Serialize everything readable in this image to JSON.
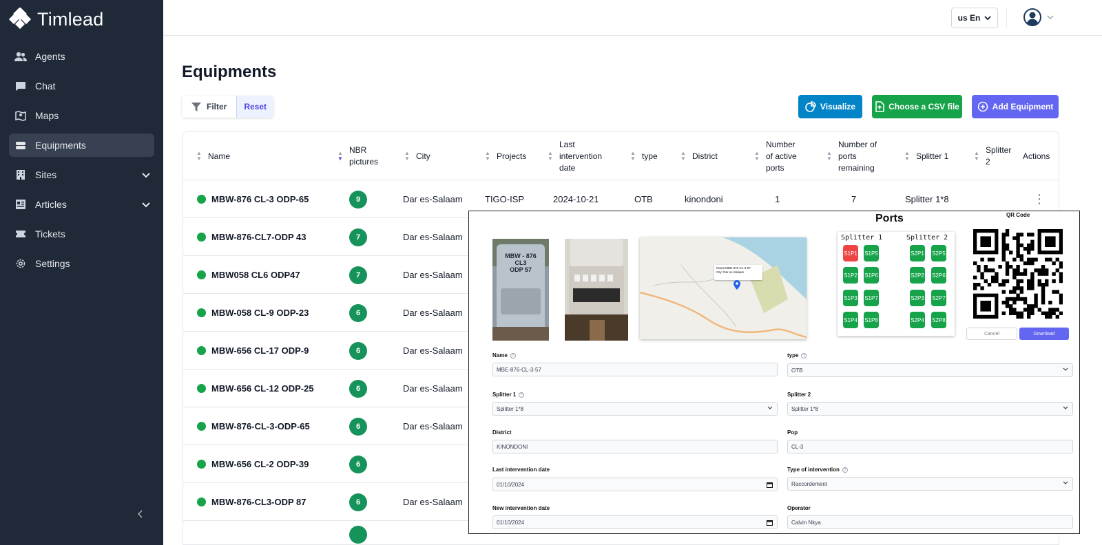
{
  "app": {
    "brand_name": "Timlead"
  },
  "sidebar": {
    "items": [
      {
        "label": "Agents",
        "icon": "users-icon"
      },
      {
        "label": "Chat",
        "icon": "chat-icon"
      },
      {
        "label": "Maps",
        "icon": "map-icon"
      },
      {
        "label": "Equipments",
        "icon": "equipment-icon",
        "active": true
      },
      {
        "label": "Sites",
        "icon": "building-icon",
        "expandable": true
      },
      {
        "label": "Articles",
        "icon": "articles-icon",
        "expandable": true
      },
      {
        "label": "Tickets",
        "icon": "ticket-icon"
      },
      {
        "label": "Settings",
        "icon": "gear-icon"
      }
    ]
  },
  "header": {
    "language": "us En"
  },
  "page": {
    "title": "Equipments"
  },
  "toolbar": {
    "filter_label": "Filter",
    "reset_label": "Reset",
    "visualize_label": "Visualize",
    "csv_label": "Choose a CSV file",
    "add_label": "Add Equipment"
  },
  "table": {
    "columns": {
      "name": "Name",
      "pictures_1": "NBR",
      "pictures_2": "pictures",
      "city": "City",
      "projects": "Projects",
      "date_1": "Last",
      "date_2": "intervention",
      "date_3": "date",
      "type": "type",
      "district": "District",
      "active_1": "Number",
      "active_2": "of active",
      "active_3": "ports",
      "remain_1": "Number of",
      "remain_2": "ports",
      "remain_3": "remaining",
      "splitter1": "Splitter 1",
      "splitter2_1": "Splitter",
      "splitter2_2": "2",
      "actions": "Actions"
    },
    "rows": [
      {
        "name": "MBW-876 CL-3 ODP-65",
        "pictures": "9",
        "city": "Dar es-Salaam",
        "projects": "TIGO-ISP",
        "date": "2024-10-21",
        "type": "OTB",
        "district": "kinondoni",
        "active": "1",
        "remaining": "7",
        "splitter1": "Splitter 1*8"
      },
      {
        "name": "MBW-876-CL7-ODP 43",
        "pictures": "7",
        "city": "Dar es-Salaam"
      },
      {
        "name": "MBW058 CL6 ODP47",
        "pictures": "7",
        "city": "Dar es-Salaam"
      },
      {
        "name": "MBW-058 CL-9 ODP-23",
        "pictures": "6",
        "city": "Dar es-Salaam"
      },
      {
        "name": "MBW-656 CL-17 ODP-9",
        "pictures": "6",
        "city": "Dar es-Salaam"
      },
      {
        "name": "MBW-656 CL-12 ODP-25",
        "pictures": "6",
        "city": "Dar es-Salaam"
      },
      {
        "name": "MBW-876-CL-3-ODP-65",
        "pictures": "6",
        "city": "Dar es-Salaam"
      },
      {
        "name": "MBW-656 CL-2 ODP-39",
        "pictures": "6",
        "city": ""
      },
      {
        "name": "MBW-876-CL3-ODP 87",
        "pictures": "6",
        "city": "Dar es-Salaam"
      }
    ]
  },
  "detail": {
    "ports_title": "Ports",
    "qr_title": "QR Code",
    "photo_label": "MBW - 876\nCL3\nODP 57",
    "map_popup_name": "Name:MBE-876-CL-3-57",
    "map_popup_city": "City: Dar es-Salaam",
    "splitter1_title": "Splitter 1",
    "splitter2_title": "Splitter 2",
    "ports_s1": [
      "S1P1",
      "S1P5",
      "S1P2",
      "S1P6",
      "S1P3",
      "S1P7",
      "S1P4",
      "S1P8"
    ],
    "ports_s2": [
      "S2P1",
      "S2P5",
      "S2P2",
      "S2P6",
      "S2P3",
      "S2P7",
      "S2P4",
      "S2P8"
    ],
    "cancel_label": "Cancel",
    "download_label": "Download",
    "fields": {
      "name_label": "Name",
      "name_value": "MBE-876-CL-3-57",
      "type_label": "type",
      "type_value": "OTB",
      "splitter1_label": "Splitter 1",
      "splitter1_value": "Splitter 1*8",
      "splitter2_label": "Splitter 2",
      "splitter2_value": "Splitter 1*8",
      "district_label": "District",
      "district_value": "KINONDONI",
      "pop_label": "Pop",
      "pop_value": "CL-3",
      "last_date_label": "Last intervention date",
      "last_date_value": "01/10/2024",
      "intervention_type_label": "Type of intervention",
      "intervention_type_value": "Raccordement",
      "new_date_label": "New intervention date",
      "new_date_value": "01/10/2024",
      "operator_label": "Operator",
      "operator_value": "Calvin Nkya"
    }
  },
  "colors": {
    "sidebar": "#1f2937",
    "accent": "#6366f1",
    "success": "#16a34a",
    "info": "#0284c7",
    "danger": "#ef4444"
  }
}
